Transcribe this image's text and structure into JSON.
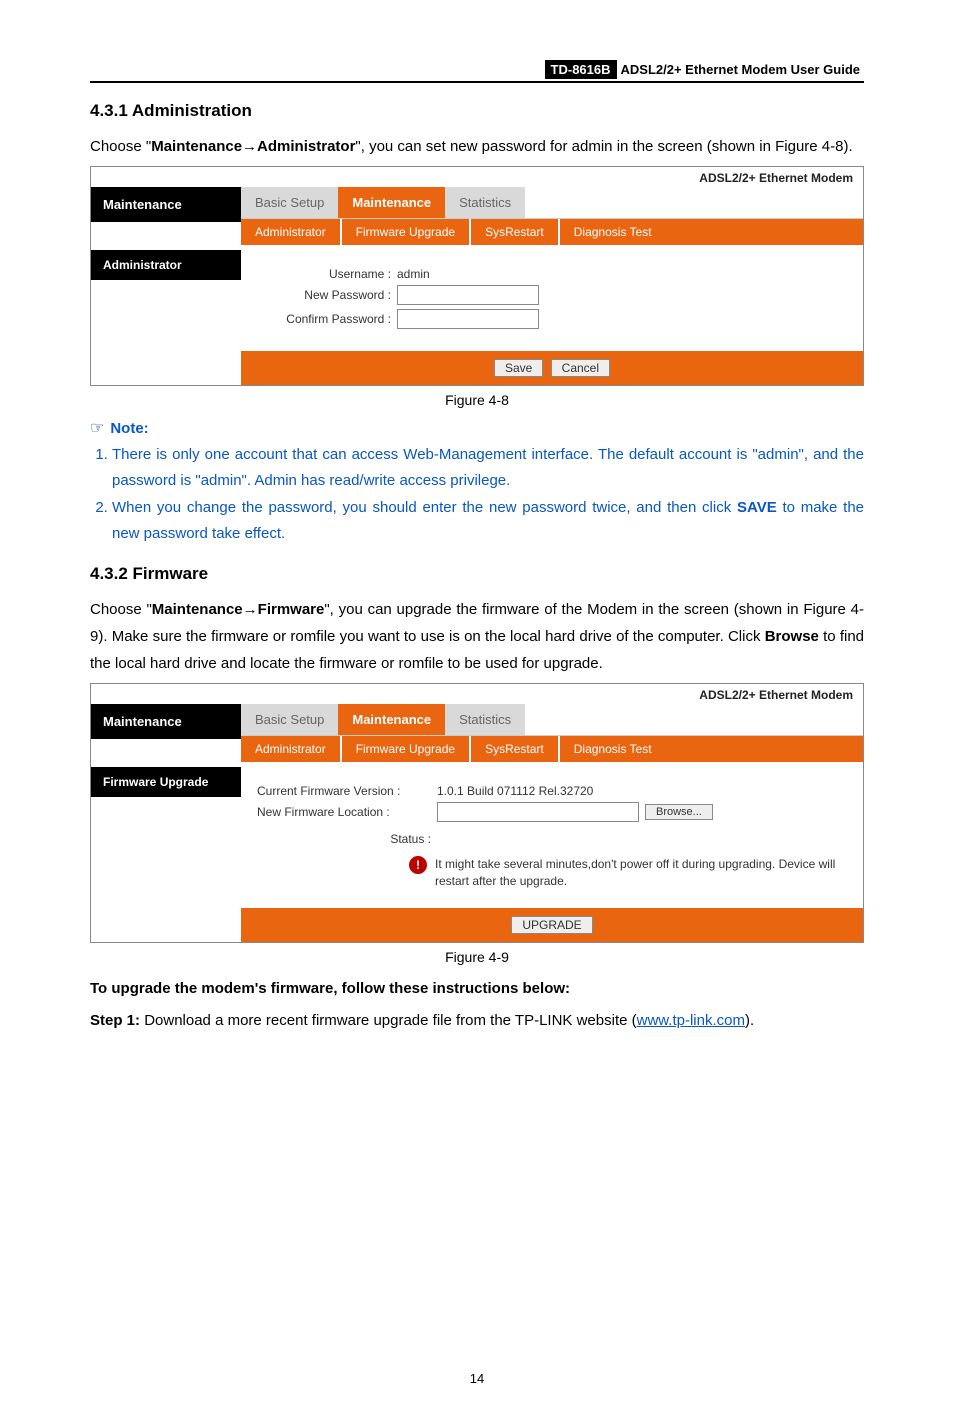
{
  "header": {
    "model": "TD-8616B",
    "rest": " ADSL2/2+  Ethernet  Modem  User  Guide "
  },
  "s431": {
    "title": "4.3.1  Administration",
    "p1_a": "Choose \"",
    "p1_b": "Maintenance→Administrator",
    "p1_c": "\", you can set new password for admin in the screen (shown in Figure 4-8).",
    "figcap": "Figure 4-8"
  },
  "shot1": {
    "brand": "ADSL2/2+ Ethernet Modem",
    "side1": "Maintenance",
    "side2": "Administrator",
    "tabs": {
      "basic": "Basic Setup",
      "maint": "Maintenance",
      "stats": "Statistics"
    },
    "subtabs": {
      "admin": "Administrator",
      "fw": "Firmware Upgrade",
      "sys": "SysRestart",
      "diag": "Diagnosis Test"
    },
    "rows": {
      "user_l": "Username :",
      "user_v": "admin",
      "np_l": "New Password :",
      "cp_l": "Confirm Password :"
    },
    "btns": {
      "save": "Save",
      "cancel": "Cancel"
    }
  },
  "note": {
    "label": "Note:",
    "i1": "There is only one account that can access Web-Management interface. The default account is \"admin\", and the password is \"admin\". Admin has read/write access privilege.",
    "i2a": "When you change the password, you should enter the new password twice, and then click ",
    "i2b": "SAVE",
    "i2c": " to make the new password take effect."
  },
  "s432": {
    "title": "4.3.2  Firmware",
    "p_a": "Choose \"",
    "p_b": "Maintenance→Firmware",
    "p_c": "\", you can upgrade the firmware of the Modem in the screen (shown in Figure 4-9). Make sure the firmware or romfile you want to use is on the local hard drive of the computer. Click ",
    "p_d": "Browse",
    "p_e": " to find the local hard drive and locate the firmware or romfile to be used for upgrade.",
    "figcap": "Figure 4-9"
  },
  "shot2": {
    "brand": "ADSL2/2+ Ethernet Modem",
    "side1": "Maintenance",
    "side2": "Firmware Upgrade",
    "cfv_l": "Current Firmware Version :",
    "cfv_v": "1.0.1 Build 071112 Rel.32720",
    "nfl_l": "New Firmware Location :",
    "browse": "Browse...",
    "status_l": "Status :",
    "warn": "It might take several minutes,don't power off it during upgrading. Device will restart after the upgrade.",
    "btn": "UPGRADE"
  },
  "upg": {
    "h": "To upgrade the modem's firmware, follow these instructions below:",
    "step_l": "Step 1:",
    "step_t": " Download a more recent firmware upgrade file from the TP-LINK website (",
    "link": "www.tp-link.com",
    "step_end": ")."
  },
  "pgnum": "14"
}
